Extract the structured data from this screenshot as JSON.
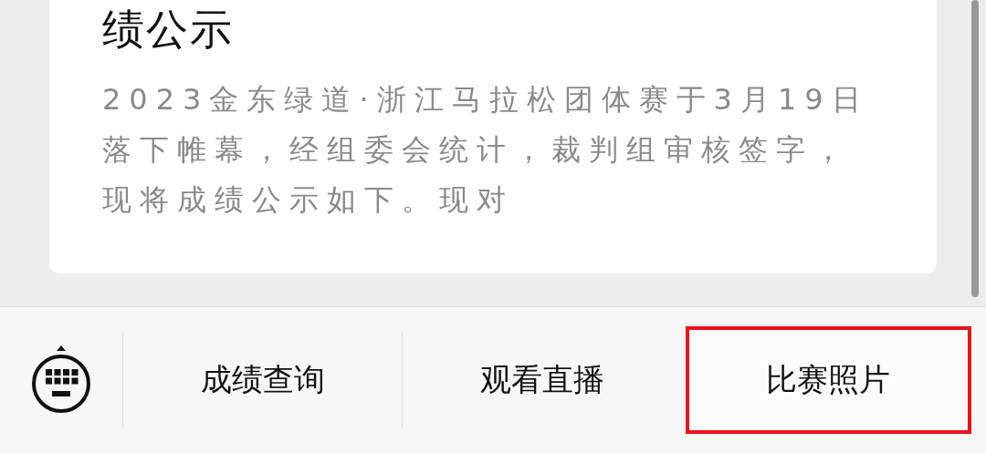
{
  "article": {
    "title": "绩公示",
    "summary": "2023金东绿道·浙江马拉松团体赛于3月19日落下帷幕，经组委会统计，裁判组审核签字，现将成绩公示如下。现对"
  },
  "menu": {
    "items": [
      {
        "label": "成绩查询",
        "highlighted": false
      },
      {
        "label": "观看直播",
        "highlighted": false
      },
      {
        "label": "比赛照片",
        "highlighted": true
      }
    ]
  }
}
